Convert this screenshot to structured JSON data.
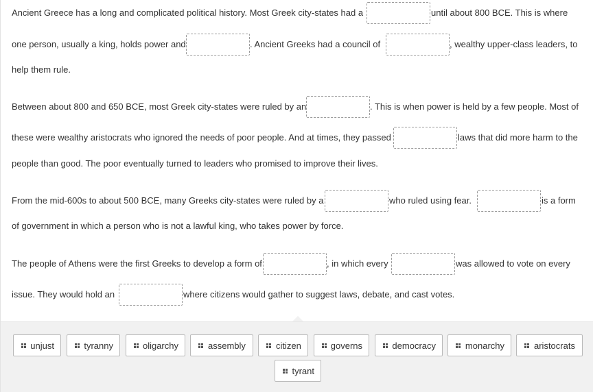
{
  "paragraphs": [
    {
      "lines": [
        {
          "parts": [
            {
              "t": "Ancient Greece has a long and complicated political history. Most Greek city-states had a"
            },
            {
              "blank": true
            },
            {
              "t": "until about 800 BCE.  This is where"
            }
          ]
        },
        {
          "parts": [
            {
              "t": "one person, usually a king, holds power and"
            },
            {
              "blank": true
            },
            {
              "t": ".  Ancient Greeks had a council of"
            },
            {
              "blank": true
            },
            {
              "t": ", wealthy upper-class leaders, to"
            }
          ]
        },
        {
          "parts": [
            {
              "t": "help them rule."
            }
          ]
        }
      ]
    },
    {
      "lines": [
        {
          "parts": [
            {
              "t": "Between about 800 and 650 BCE, most Greek city-states were ruled by an"
            },
            {
              "blank": true
            },
            {
              "t": ".  This is when power is held by a few people.  Most of"
            }
          ]
        },
        {
          "parts": [
            {
              "t": "these were wealthy aristocrats who ignored the needs of poor people.  And at times, they passed"
            },
            {
              "blank": true
            },
            {
              "t": "laws that did more harm to the"
            }
          ]
        },
        {
          "parts": [
            {
              "t": "people than good.  The poor eventually turned to leaders who promised to improve their lives."
            }
          ]
        }
      ]
    },
    {
      "lines": [
        {
          "parts": [
            {
              "t": "From the mid-600s to about 500 BCE, many Greeks city-states were ruled by a"
            },
            {
              "blank": true
            },
            {
              "t": "who ruled using fear."
            },
            {
              "blank": true
            },
            {
              "t": " is a form"
            }
          ]
        },
        {
          "parts": [
            {
              "t": "of government in which a person who is not a lawful king, who takes power by force."
            }
          ]
        }
      ]
    },
    {
      "lines": [
        {
          "parts": [
            {
              "t": "The people of Athens were the first Greeks to develop a form of"
            },
            {
              "blank": true
            },
            {
              "t": ", in which every"
            },
            {
              "blank": true
            },
            {
              "t": "was allowed to vote on every"
            }
          ]
        },
        {
          "parts": [
            {
              "t": "issue.  They would hold an"
            },
            {
              "blank": true
            },
            {
              "t": "where citizens would gather to suggest laws, debate, and cast votes."
            }
          ]
        }
      ]
    }
  ],
  "word_bank": [
    {
      "label": "unjust"
    },
    {
      "label": "tyranny"
    },
    {
      "label": "oligarchy"
    },
    {
      "label": "assembly"
    },
    {
      "label": "citizen"
    },
    {
      "label": "governs"
    },
    {
      "label": "democracy"
    },
    {
      "label": "monarchy"
    },
    {
      "label": "aristocrats"
    },
    {
      "label": "tyrant"
    }
  ],
  "icons": {
    "chip_handle": "drag-handle-icon"
  }
}
